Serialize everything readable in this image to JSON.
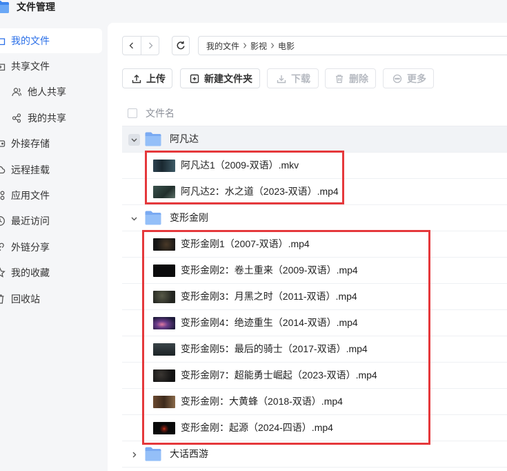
{
  "app": {
    "title": "文件管理",
    "logo_icon": "folder-icon"
  },
  "colors": {
    "accent": "#2a6fe8",
    "folder": "#94bff8",
    "annotation": "#e5383b",
    "disabled": "#b6bac1"
  },
  "sidebar": {
    "items": [
      {
        "label": "我的文件",
        "icon": "folder-icon",
        "selected": true
      },
      {
        "label": "共享文件",
        "icon": "share-folder-icon"
      },
      {
        "label": "他人共享",
        "icon": "person-icon",
        "child": true
      },
      {
        "label": "我的共享",
        "icon": "share-nodes-icon",
        "child": true
      },
      {
        "label": "外接存储",
        "icon": "external-drive-icon"
      },
      {
        "label": "远程挂载",
        "icon": "remote-mount-icon"
      },
      {
        "label": "应用文件",
        "icon": "apps-icon"
      },
      {
        "label": "最近访问",
        "icon": "clock-icon"
      },
      {
        "label": "外链分享",
        "icon": "link-icon"
      },
      {
        "label": "我的收藏",
        "icon": "star-icon"
      },
      {
        "label": "回收站",
        "icon": "trash-icon"
      }
    ]
  },
  "navigation": {
    "back_icon": "chevron-left-icon",
    "forward_icon": "chevron-right-icon",
    "refresh_icon": "refresh-icon"
  },
  "breadcrumb": {
    "items": [
      "我的文件",
      "影视",
      "电影"
    ]
  },
  "actions": [
    {
      "label": "上传",
      "icon": "upload-icon",
      "disabled": false
    },
    {
      "label": "新建文件夹",
      "icon": "new-folder-icon",
      "disabled": false
    },
    {
      "label": "下载",
      "icon": "download-icon",
      "disabled": true
    },
    {
      "label": "删除",
      "icon": "delete-icon",
      "disabled": true
    },
    {
      "label": "更多",
      "icon": "more-icon",
      "disabled": true
    }
  ],
  "file_list": {
    "header": {
      "name": "文件名"
    },
    "folders": [
      {
        "name": "阿凡达",
        "expanded": true,
        "files": [
          {
            "name": "阿凡达1（2009-双语）.mkv"
          },
          {
            "name": "阿凡达2：水之道（2023-双语）.mp4"
          }
        ]
      },
      {
        "name": "变形金刚",
        "expanded": true,
        "files": [
          {
            "name": "变形金刚1（2007-双语）.mp4"
          },
          {
            "name": "变形金刚2：卷土重来（2009-双语）.mp4"
          },
          {
            "name": "变形金刚3：月黑之时（2011-双语）.mp4"
          },
          {
            "name": "变形金刚4：绝迹重生（2014-双语）.mp4"
          },
          {
            "name": "变形金刚5：最后的骑士（2017-双语）.mp4"
          },
          {
            "name": "变形金刚7：超能勇士崛起（2023-双语）.mp4"
          },
          {
            "name": "变形金刚：大黄蜂（2018-双语）.mp4"
          },
          {
            "name": "变形金刚：起源（2024-四语）.mp4"
          }
        ]
      },
      {
        "name": "大话西游",
        "expanded": false,
        "files": []
      }
    ]
  }
}
